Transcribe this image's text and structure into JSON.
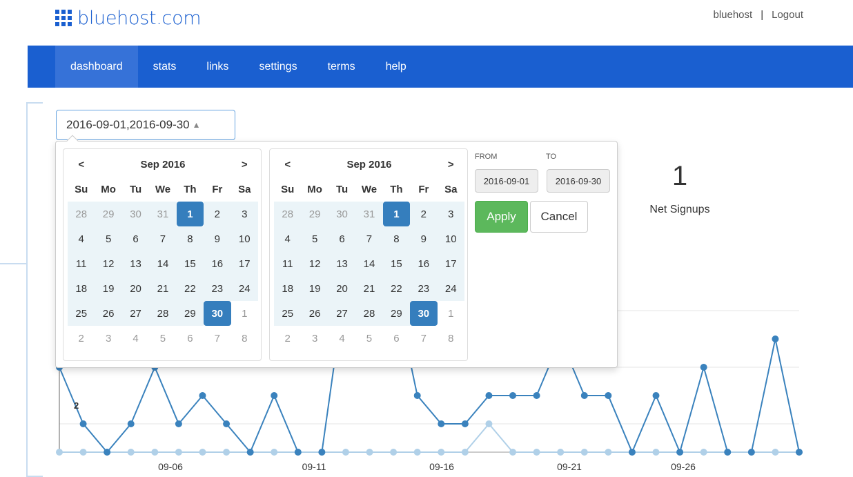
{
  "header": {
    "logo_text": "bluehost.com",
    "user_name": "bluehost",
    "separator": "|",
    "logout_label": "Logout"
  },
  "nav": {
    "items": [
      {
        "label": "dashboard",
        "active": true
      },
      {
        "label": "stats",
        "active": false
      },
      {
        "label": "links",
        "active": false
      },
      {
        "label": "settings",
        "active": false
      },
      {
        "label": "terms",
        "active": false
      },
      {
        "label": "help",
        "active": false
      }
    ]
  },
  "range_picker": {
    "value": "2016-09-01,2016-09-30",
    "caret": "▲"
  },
  "stat": {
    "value": "1",
    "label": "Net Signups"
  },
  "datepicker": {
    "left_calendar": {
      "prev": "<",
      "next": ">",
      "month": "Sep 2016",
      "weekdays": [
        "Su",
        "Mo",
        "Tu",
        "We",
        "Th",
        "Fr",
        "Sa"
      ],
      "weeks": [
        [
          "28",
          "29",
          "30",
          "31",
          "1",
          "2",
          "3"
        ],
        [
          "4",
          "5",
          "6",
          "7",
          "8",
          "9",
          "10"
        ],
        [
          "11",
          "12",
          "13",
          "14",
          "15",
          "16",
          "17"
        ],
        [
          "18",
          "19",
          "20",
          "21",
          "22",
          "23",
          "24"
        ],
        [
          "25",
          "26",
          "27",
          "28",
          "29",
          "30",
          "1"
        ],
        [
          "2",
          "3",
          "4",
          "5",
          "6",
          "7",
          "8"
        ]
      ]
    },
    "right_calendar": {
      "prev": "<",
      "next": ">",
      "month": "Sep 2016",
      "weekdays": [
        "Su",
        "Mo",
        "Tu",
        "We",
        "Th",
        "Fr",
        "Sa"
      ],
      "weeks": [
        [
          "28",
          "29",
          "30",
          "31",
          "1",
          "2",
          "3"
        ],
        [
          "4",
          "5",
          "6",
          "7",
          "8",
          "9",
          "10"
        ],
        [
          "11",
          "12",
          "13",
          "14",
          "15",
          "16",
          "17"
        ],
        [
          "18",
          "19",
          "20",
          "21",
          "22",
          "23",
          "24"
        ],
        [
          "25",
          "26",
          "27",
          "28",
          "29",
          "30",
          "1"
        ],
        [
          "2",
          "3",
          "4",
          "5",
          "6",
          "7",
          "8"
        ]
      ]
    },
    "start_date": "2016-09-01",
    "end_date": "2016-09-30",
    "from_label": "FROM",
    "to_label": "TO",
    "from_value": "2016-09-01",
    "to_value": "2016-09-30",
    "apply_label": "Apply",
    "cancel_label": "Cancel"
  },
  "chart_data": {
    "type": "line",
    "x": [
      "09-01",
      "09-02",
      "09-03",
      "09-04",
      "09-05",
      "09-06",
      "09-07",
      "09-08",
      "09-09",
      "09-10",
      "09-11",
      "09-12",
      "09-13",
      "09-14",
      "09-15",
      "09-16",
      "09-17",
      "09-18",
      "09-19",
      "09-20",
      "09-21",
      "09-22",
      "09-23",
      "09-24",
      "09-25",
      "09-26",
      "09-27",
      "09-28",
      "09-29",
      "09-30"
    ],
    "x_tick_labels": [
      "09-06",
      "09-11",
      "09-16",
      "09-21",
      "09-26"
    ],
    "y_tick_labels": [
      "2"
    ],
    "ylim": [
      0,
      4
    ],
    "series": [
      {
        "color": "#3a82bd",
        "values": [
          3,
          1,
          0,
          1,
          3,
          1,
          2,
          1,
          0,
          2,
          0,
          0,
          6,
          6,
          6,
          2,
          1,
          1,
          2,
          2,
          2,
          4,
          2,
          2,
          0,
          2,
          0,
          3,
          0,
          0,
          4,
          0
        ]
      },
      {
        "color": "#b0d0e8",
        "values": [
          0,
          0,
          0,
          0,
          0,
          0,
          0,
          0,
          0,
          0,
          0,
          0,
          0,
          0,
          0,
          0,
          0,
          0,
          1,
          0,
          0,
          0,
          0,
          0,
          0,
          0,
          0,
          0,
          0,
          0,
          0,
          0
        ]
      }
    ],
    "grid": true
  }
}
